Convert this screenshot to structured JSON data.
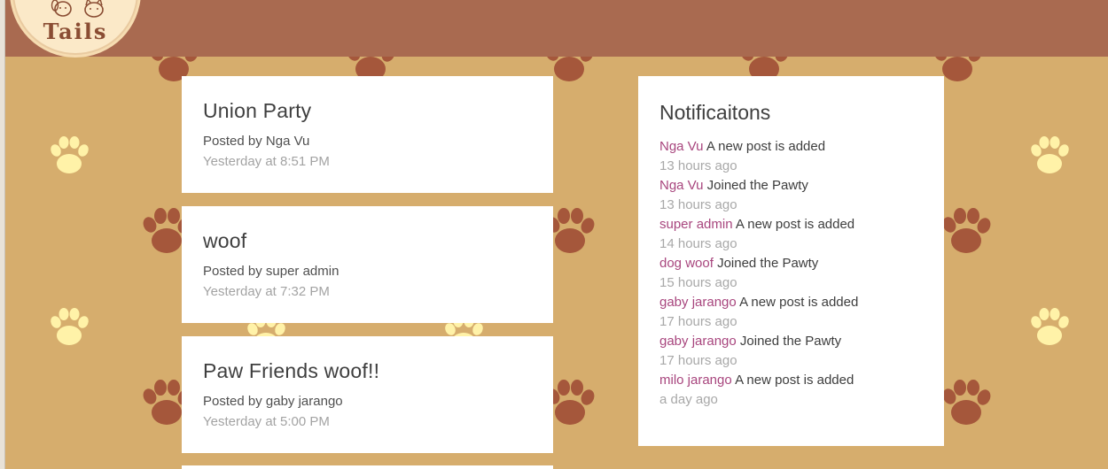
{
  "brand": {
    "logo_text": "Tails"
  },
  "posts": [
    {
      "title": "Union Party",
      "posted_by_prefix": "Posted by",
      "author": "Nga Vu",
      "time": "Yesterday at 8:51 PM"
    },
    {
      "title": "woof",
      "posted_by_prefix": "Posted by",
      "author": "super admin",
      "time": "Yesterday at 7:32 PM"
    },
    {
      "title": "Paw Friends woof!!",
      "posted_by_prefix": "Posted by",
      "author": "gaby jarango",
      "time": "Yesterday at 5:00 PM"
    }
  ],
  "notifications": {
    "title": "Notificaitons",
    "items": [
      {
        "user": "Nga Vu",
        "action": "A new post is added",
        "ago": "13 hours ago"
      },
      {
        "user": "Nga Vu",
        "action": "Joined the Pawty",
        "ago": "13 hours ago"
      },
      {
        "user": "super admin",
        "action": "A new post is added",
        "ago": "14 hours ago"
      },
      {
        "user": "dog woof",
        "action": "Joined the Pawty",
        "ago": "15 hours ago"
      },
      {
        "user": "gaby jarango",
        "action": "A new post is added",
        "ago": "17 hours ago"
      },
      {
        "user": "gaby jarango",
        "action": "Joined the Pawty",
        "ago": "17 hours ago"
      },
      {
        "user": "milo jarango",
        "action": "A new post is added",
        "ago": "a day ago"
      }
    ]
  },
  "colors": {
    "background": "#d6ad6d",
    "header": "#a96a50",
    "paw_brown": "#a5573b",
    "paw_cream": "#fff2a8",
    "user_link": "#a8467e"
  },
  "icons": [
    "paw-print-icon",
    "dog-face-icon",
    "cat-face-icon"
  ]
}
